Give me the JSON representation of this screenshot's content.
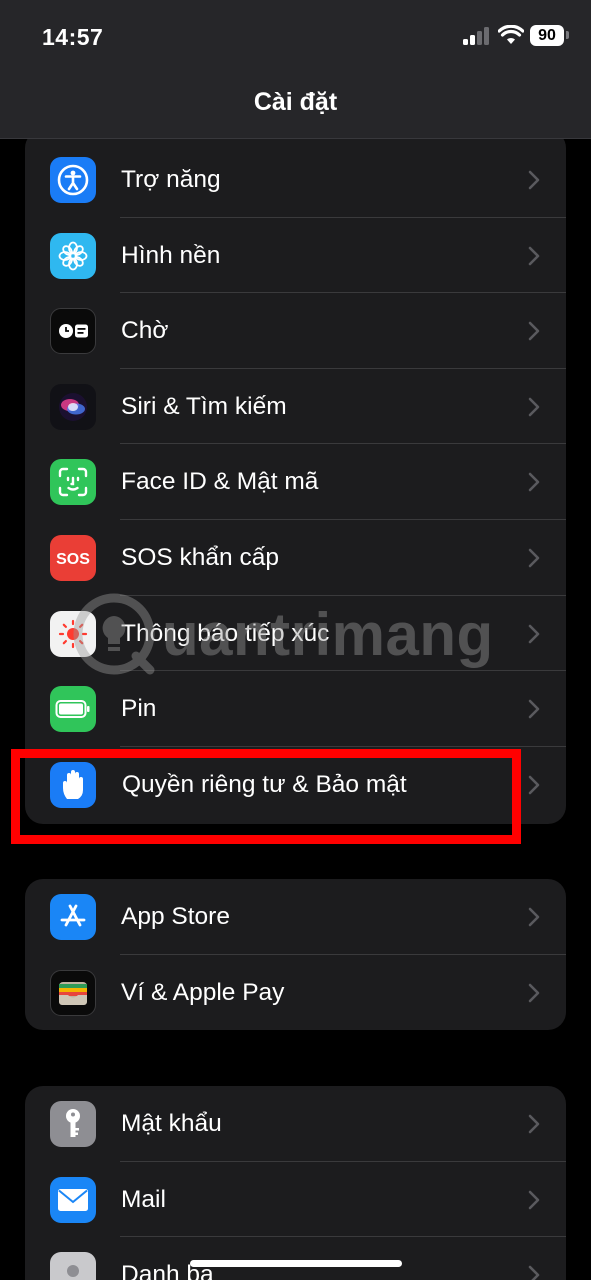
{
  "status_bar": {
    "time": "14:57",
    "battery": "90"
  },
  "header": {
    "title": "Cài đặt"
  },
  "groups": [
    {
      "items": [
        {
          "label": "Trợ năng",
          "icon": "accessibility-icon",
          "color": "#1a7cf6"
        },
        {
          "label": "Hình nền",
          "icon": "wallpaper-flower-icon",
          "color": "#2fb8f0"
        },
        {
          "label": "Chờ",
          "icon": "standby-icon",
          "color": "#0a0a0a"
        },
        {
          "label": "Siri & Tìm kiếm",
          "icon": "siri-icon",
          "color": "#111116"
        },
        {
          "label": "Face ID & Mật mã",
          "icon": "face-id-icon",
          "color": "#30c55a"
        },
        {
          "label": "SOS khẩn cấp",
          "icon": "sos-icon",
          "color": "#ea3e36"
        },
        {
          "label": "Thông báo tiếp xúc",
          "icon": "exposure-notification-icon",
          "color": "#f2f2f2"
        },
        {
          "label": "Pin",
          "icon": "battery-icon",
          "color": "#30c55a"
        },
        {
          "label": "Quyền riêng tư & Bảo mật",
          "icon": "privacy-hand-icon",
          "color": "#1a7cf6"
        }
      ]
    },
    {
      "items": [
        {
          "label": "App Store",
          "icon": "app-store-icon",
          "color": "#1a86f6"
        },
        {
          "label": "Ví & Apple Pay",
          "icon": "wallet-icon",
          "color": "#0a0a0a"
        }
      ]
    },
    {
      "items": [
        {
          "label": "Mật khẩu",
          "icon": "key-icon",
          "color": "#8e8e93"
        },
        {
          "label": "Mail",
          "icon": "mail-icon",
          "color": "#1a86f6"
        },
        {
          "label": "Danh bạ",
          "icon": "contacts-icon",
          "color": "#c9c9cc"
        }
      ]
    }
  ],
  "watermark": {
    "text": "uantrimang"
  }
}
